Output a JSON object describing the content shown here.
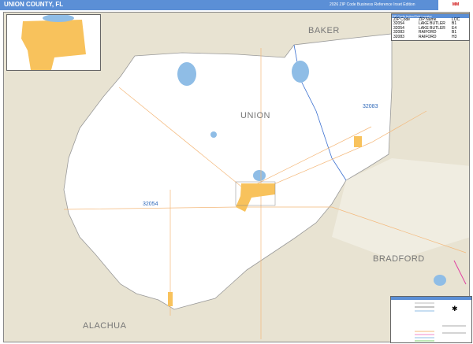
{
  "header": {
    "title": "UNION COUNTY, FL",
    "edition": "2026 ZIP Code Business Reference Inset Edition",
    "logo_text": "MARKET MAPS"
  },
  "map": {
    "counties": [
      "UNION",
      "BAKER",
      "BRADFORD",
      "ALACHUA"
    ],
    "zip_labels": [
      "32054",
      "32083"
    ],
    "colors": {
      "background": "#e8e3d2",
      "county": "#ffffff",
      "urban": "#f8c25c",
      "water": "#8fbde6",
      "header": "#5b8fd6",
      "zip_boundary": "#3a6fd0"
    }
  },
  "zip_index": {
    "title": "ZIP Code Index/Grid Locator",
    "columns": [
      "ZIP Code",
      "ZIP Name",
      "LOC"
    ],
    "rows": [
      [
        "32054",
        "LAKE BUTLER",
        "B1"
      ],
      [
        "32054",
        "LAKE BUTLER",
        "E4"
      ],
      [
        "32083",
        "RAIFORD",
        "B1"
      ],
      [
        "32083",
        "RAIFORD",
        "H3"
      ]
    ]
  }
}
